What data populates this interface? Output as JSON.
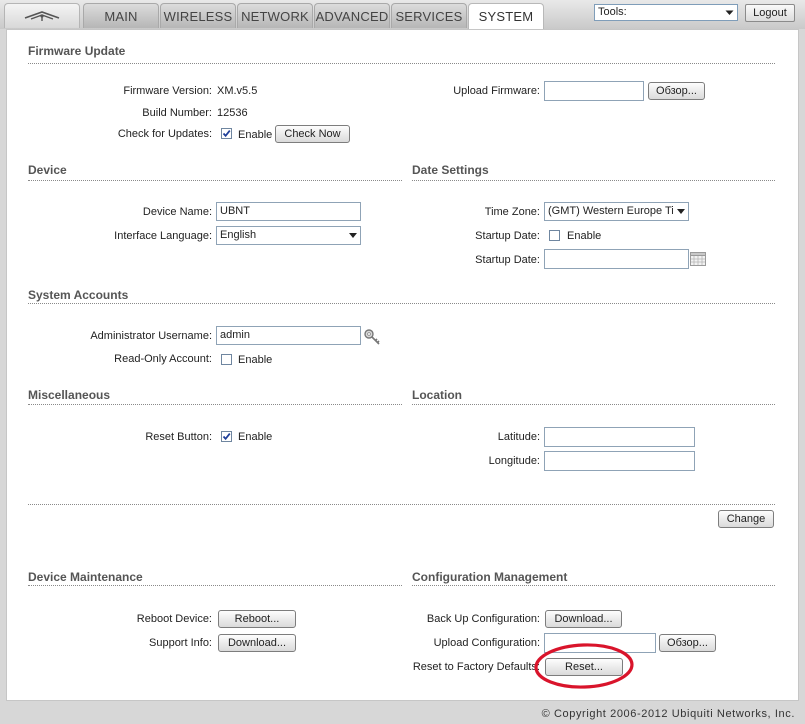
{
  "nav": {
    "tabs": [
      {
        "label": "MAIN",
        "active": false
      },
      {
        "label": "WIRELESS",
        "active": false
      },
      {
        "label": "NETWORK",
        "active": false
      },
      {
        "label": "ADVANCED",
        "active": false
      },
      {
        "label": "SERVICES",
        "active": false
      },
      {
        "label": "SYSTEM",
        "active": true
      }
    ],
    "tools_label": "Tools:",
    "logout_label": "Logout"
  },
  "firmware": {
    "title": "Firmware Update",
    "version_label": "Firmware Version:",
    "version_value": "XM.v5.5",
    "build_label": "Build Number:",
    "build_value": "12536",
    "check_label": "Check for Updates:",
    "check_enabled": true,
    "enable_text": "Enable",
    "check_now_label": "Check Now",
    "upload_label": "Upload Firmware:",
    "upload_value": "",
    "browse_label": "Обзор..."
  },
  "device": {
    "title": "Device",
    "name_label": "Device Name:",
    "name_value": "UBNT",
    "language_label": "Interface Language:",
    "language_value": "English"
  },
  "date": {
    "title": "Date Settings",
    "timezone_label": "Time Zone:",
    "timezone_value": "(GMT) Western Europe Ti",
    "startup_label": "Startup Date:",
    "startup_enabled": false,
    "enable_text": "Enable",
    "startup_date_label": "Startup Date:",
    "startup_date_value": ""
  },
  "accounts": {
    "title": "System Accounts",
    "admin_label": "Administrator Username:",
    "admin_value": "admin",
    "readonly_label": "Read-Only Account:",
    "readonly_enabled": false,
    "enable_text": "Enable"
  },
  "misc": {
    "title": "Miscellaneous",
    "reset_label": "Reset Button:",
    "reset_enabled": true,
    "enable_text": "Enable"
  },
  "location": {
    "title": "Location",
    "latitude_label": "Latitude:",
    "latitude_value": "",
    "longitude_label": "Longitude:",
    "longitude_value": ""
  },
  "change_label": "Change",
  "maintenance": {
    "title": "Device Maintenance",
    "reboot_label": "Reboot Device:",
    "reboot_button": "Reboot...",
    "support_label": "Support Info:",
    "support_button": "Download..."
  },
  "config": {
    "title": "Configuration Management",
    "backup_label": "Back Up Configuration:",
    "backup_button": "Download...",
    "upload_label": "Upload Configuration:",
    "upload_value": "",
    "browse_label": "Обзор...",
    "factory_label": "Reset to Factory Defaults:",
    "reset_button": "Reset..."
  },
  "footer": {
    "copyright": "© Copyright 2006-2012 Ubiquiti Networks, Inc."
  },
  "colors": {
    "annotation_red": "#d9142b",
    "check_blue": "#1f3f9a"
  }
}
